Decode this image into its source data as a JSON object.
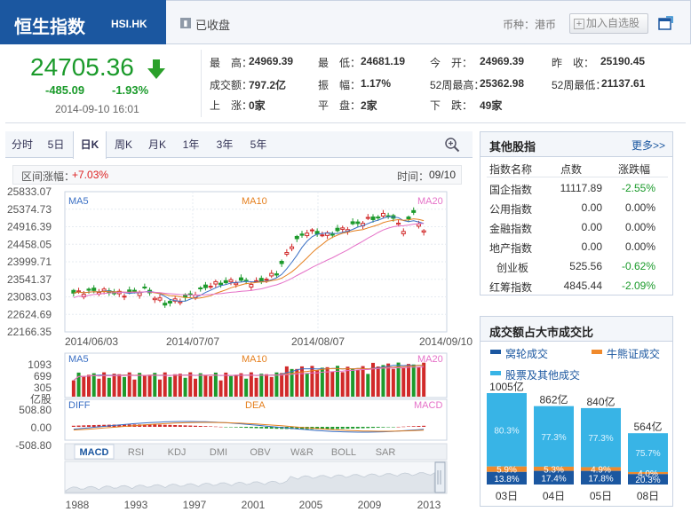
{
  "header": {
    "index_name": "恒生指数",
    "code": "HSI.HK",
    "status": "已收盘",
    "currency_label": "币种：港币",
    "add_button": "加入自选股"
  },
  "quote": {
    "price": "24705.36",
    "change": "-485.09",
    "change_pct": "-1.93%",
    "time": "2014-09-10 16:01",
    "stats": [
      {
        "label": "最　高：",
        "value": "24969.39"
      },
      {
        "label": "最　低：",
        "value": "24681.19"
      },
      {
        "label": "今　开：",
        "value": "24969.39"
      },
      {
        "label": "昨　收：",
        "value": "25190.45"
      },
      {
        "label": "成交额：",
        "value": "797.2亿"
      },
      {
        "label": "振　幅：",
        "value": "1.17%"
      },
      {
        "label": "52周最高：",
        "value": "25362.98"
      },
      {
        "label": "52周最低：",
        "value": "21137.61"
      },
      {
        "label": "上　涨：",
        "value": "0家"
      },
      {
        "label": "平　盘：",
        "value": "2家"
      },
      {
        "label": "下　跌：",
        "value": "49家"
      }
    ]
  },
  "tabs": [
    "分时",
    "5日",
    "日K",
    "周K",
    "月K",
    "1年",
    "3年",
    "5年"
  ],
  "active_tab": "日K",
  "range": {
    "label": "区间涨幅：",
    "value": "+7.03%",
    "time_label": "时间：",
    "time_value": "09/10"
  },
  "kchart": {
    "y_ticks": [
      "25833.07",
      "25374.73",
      "24916.39",
      "24458.05",
      "23999.71",
      "23541.37",
      "23083.03",
      "22624.69",
      "22166.35"
    ],
    "x_ticks": [
      "2014/06/03",
      "2014/07/07",
      "2014/08/07",
      "2014/09/10"
    ],
    "ma_labels": [
      "MA5",
      "MA10",
      "MA20"
    ]
  },
  "volume": {
    "y_ticks": [
      "1093",
      "699",
      "305",
      "亿股"
    ],
    "ma_labels": [
      "MA5",
      "MA10",
      "MA20"
    ]
  },
  "macd": {
    "y_ticks": [
      "508.80",
      "0.00",
      "-508.80"
    ],
    "labels": [
      "DIFF",
      "DEA",
      "MACD"
    ]
  },
  "indicator_tabs": [
    "MACD",
    "RSI",
    "KDJ",
    "DMI",
    "OBV",
    "W&R",
    "BOLL",
    "SAR"
  ],
  "active_indicator": "MACD",
  "timeline_years": [
    "1988",
    "1993",
    "1997",
    "2001",
    "2005",
    "2009",
    "2013"
  ],
  "other_indices": {
    "title": "其他股指",
    "more": "更多>>",
    "columns": [
      "指数名称",
      "点数",
      "涨跌幅"
    ],
    "rows": [
      {
        "name": "国企指数",
        "points": "11117.89",
        "change": "-2.55%"
      },
      {
        "name": "公用指数",
        "points": "0.00",
        "change": "0.00%"
      },
      {
        "name": "金融指数",
        "points": "0.00",
        "change": "0.00%"
      },
      {
        "name": "地产指数",
        "points": "0.00",
        "change": "0.00%"
      },
      {
        "name": "创业板",
        "points": "525.56",
        "change": "-0.62%"
      },
      {
        "name": "红筹指数",
        "points": "4845.44",
        "change": "-2.09%"
      }
    ]
  },
  "turnover_ratio": {
    "title": "成交额占大市成交比",
    "legend": [
      "窝轮成交",
      "牛熊证成交",
      "股票及其他成交"
    ],
    "colors": {
      "warrant": "#1b57a0",
      "cbbc": "#f08a2c",
      "stock": "#38b4e6"
    },
    "days": [
      {
        "day": "03日",
        "total": "1005亿",
        "stock_pct": 80.3,
        "cbbc_pct": 5.9,
        "warrant_pct": 13.8,
        "stock_label": "80.3%",
        "cbbc_label": "5.9%",
        "warrant_label": "13.8%"
      },
      {
        "day": "04日",
        "total": "862亿",
        "stock_pct": 77.3,
        "cbbc_pct": 5.3,
        "warrant_pct": 17.4,
        "stock_label": "77.3%",
        "cbbc_label": "5.3%",
        "warrant_label": "17.4%"
      },
      {
        "day": "05日",
        "total": "840亿",
        "stock_pct": 77.3,
        "cbbc_pct": 4.9,
        "warrant_pct": 17.8,
        "stock_label": "77.3%",
        "cbbc_label": "4.9%",
        "warrant_label": "17.8%"
      },
      {
        "day": "08日",
        "total": "564亿",
        "stock_pct": 75.7,
        "cbbc_pct": 4.0,
        "warrant_pct": 20.3,
        "stock_label": "75.7%",
        "cbbc_label": "4.0%",
        "warrant_label": "20.3%"
      }
    ]
  }
}
